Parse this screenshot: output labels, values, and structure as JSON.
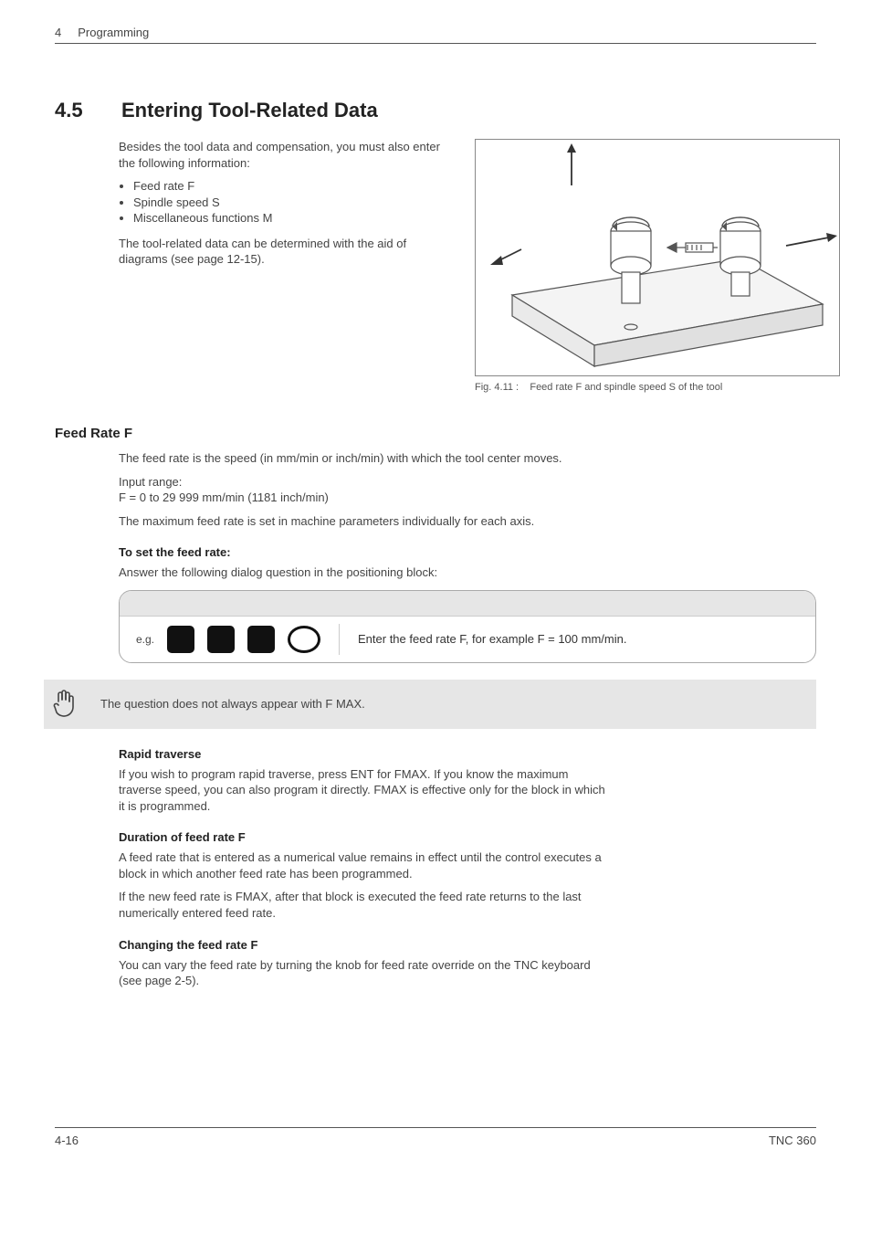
{
  "header": {
    "chapter_number": "4",
    "chapter_title": "Programming"
  },
  "section": {
    "number": "4.5",
    "title": "Entering Tool-Related Data"
  },
  "intro": {
    "p1": "Besides the tool data and compensation, you must also enter the following information:",
    "bullets": [
      "Feed rate F",
      "Spindle speed S",
      "Miscellaneous functions M"
    ],
    "p2": "The tool-related data can be determined with the aid of diagrams (see page 12-15)."
  },
  "figure": {
    "caption_prefix": "Fig. 4.11 :",
    "caption": "Feed rate F and spindle speed S of the tool"
  },
  "feedrate": {
    "heading": "Feed Rate F",
    "p1": "The feed rate is the speed (in mm/min or inch/min) with which the tool center moves.",
    "p2a": "Input range:",
    "p2b": "F = 0 to 29 999 mm/min (1181 inch/min)",
    "p3": "The maximum feed rate is set in machine parameters individually for each axis.",
    "set_heading": "To set the feed rate:",
    "set_text": "Answer the following dialog question in the positioning block:",
    "eg": "e.g.",
    "dialog_instruction": "Enter the feed rate F, for example F = 100 mm/min.",
    "note": "The question does not always appear with F MAX.",
    "rapid_heading": "Rapid traverse",
    "rapid_text": "If you wish to program rapid traverse, press ENT for FMAX. If you know the maximum traverse speed, you can also program it directly. FMAX is effective only for the block in which it is programmed.",
    "duration_heading": "Duration of feed rate F",
    "duration_p1": "A feed rate that is entered as a numerical value remains in effect until the control executes a block in which another feed rate has been programmed.",
    "duration_p2": "If the new feed rate is FMAX, after that block is executed the feed rate returns to the last numerically entered feed rate.",
    "change_heading": "Changing the feed rate F",
    "change_text": "You can vary the feed rate by turning the knob for feed rate override on the TNC keyboard  (see page 2-5)."
  },
  "footer": {
    "page": "4-16",
    "model": "TNC 360"
  }
}
